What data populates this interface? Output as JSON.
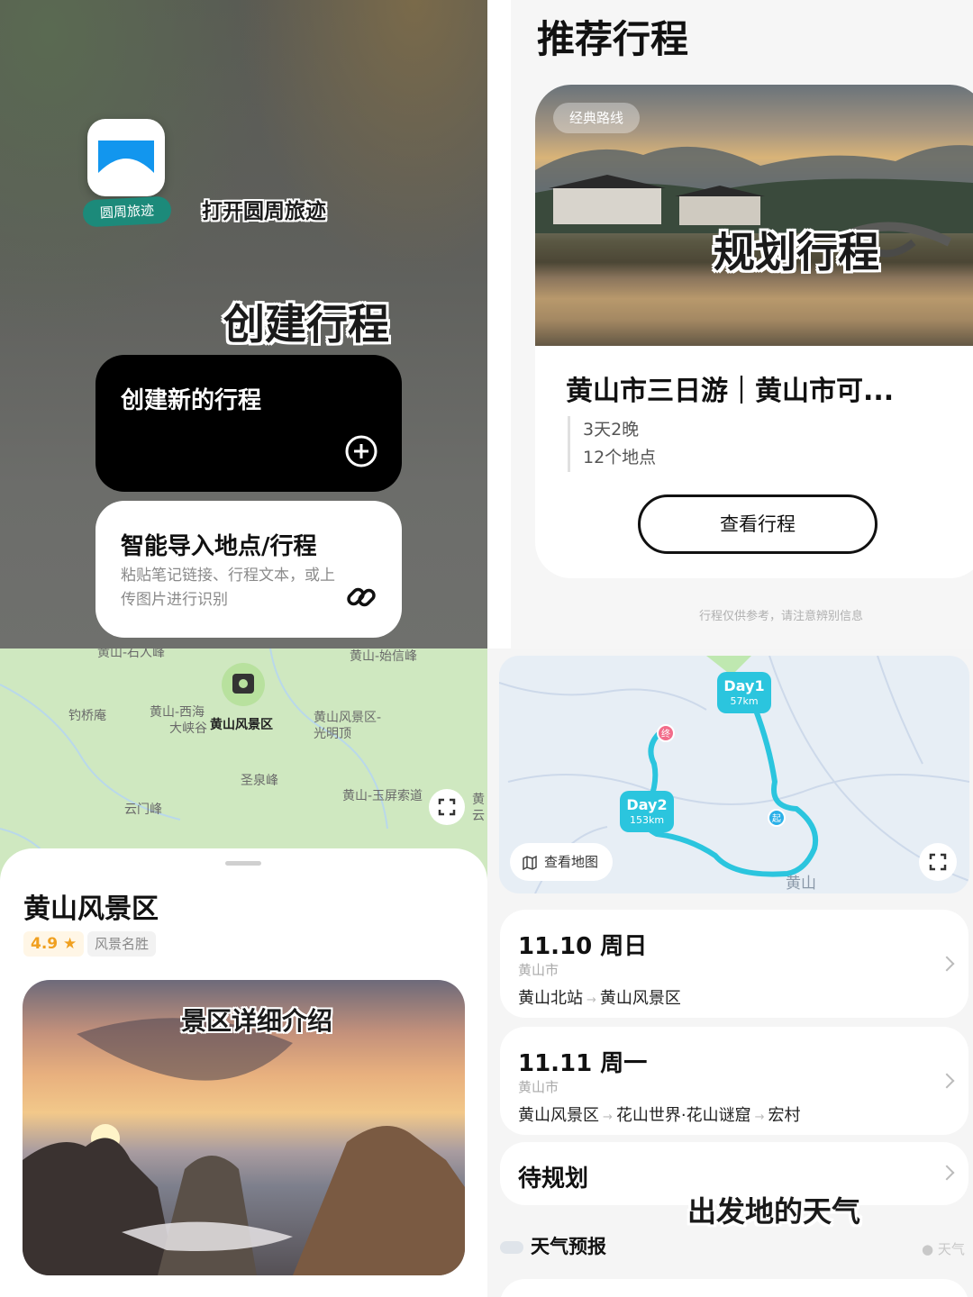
{
  "home": {
    "app_name": "圆周旅迹",
    "caption_open": "打开圆周旅迹",
    "caption_create": "创建行程",
    "menu": [
      {
        "title": "创建新的行程",
        "desc": "",
        "icon": "plus-circle-icon"
      },
      {
        "title": "智能导入地点/行程",
        "desc": "粘贴笔记链接、行程文本，或上传图片进行识别",
        "icon": "link-icon"
      }
    ],
    "colors": {
      "label_bg": "#1c8a7a",
      "icon_blue": "#1296ee"
    }
  },
  "recommend": {
    "title": "推荐行程",
    "tag": "经典路线",
    "overlay": "规划行程",
    "trip_name": "黄山市三日游｜黄山市可...",
    "duration": "3天2晚",
    "places": "12个地点",
    "view_button": "查看行程",
    "disclaimer": "行程仅供参考，请注意辨别信息"
  },
  "spot": {
    "map_labels": {
      "top_left": "黄山-石人峰",
      "top_right": "黄山-始信峰",
      "diaoqiao": "钓桥庵",
      "xihai": "黄山-西海",
      "daxiagu": "大峡谷",
      "scenic": "黄山风景区",
      "guangming_1": "黄山风景区-",
      "guangming_2": "光明顶",
      "shengquan": "圣泉峰",
      "yuping": "黄山-玉屏索道",
      "yunmen": "云门峰",
      "edge_1": "黄",
      "edge_2": "云"
    },
    "name": "黄山风景区",
    "rating": "4.9 ★",
    "category": "风景名胜",
    "overlay": "景区详细介绍"
  },
  "itinerary": {
    "days": [
      {
        "badge": "Day1",
        "km": "57km"
      },
      {
        "badge": "Day2",
        "km": "153km"
      }
    ],
    "start_pin": "起",
    "end_pin": "终",
    "map_city": "黄山",
    "view_map": "查看地图",
    "cards": [
      {
        "date": "11.10 周日",
        "city": "黄山市",
        "stops": [
          "黄山北站",
          "黄山风景区"
        ]
      },
      {
        "date": "11.11 周一",
        "city": "黄山市",
        "stops": [
          "黄山风景区",
          "花山世界·花山谜窟",
          "宏村"
        ]
      }
    ],
    "pending": "待规划",
    "overlay": "出发地的天气",
    "weather_title": "天气预报",
    "weather_source": "天气",
    "route_color": "#2bc5de"
  }
}
